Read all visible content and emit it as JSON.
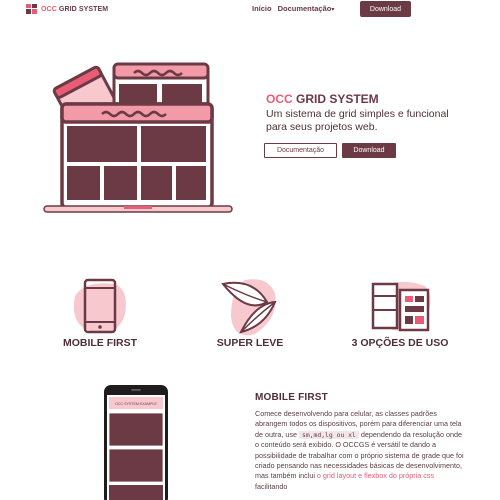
{
  "header": {
    "logo_accent": "OCC",
    "logo_rest": " GRID SYSTEM",
    "nav": [
      {
        "label": "Início"
      },
      {
        "label": "Documentação"
      }
    ],
    "nav_caret": "▾",
    "download_label": "Download"
  },
  "hero": {
    "title_accent": "OCC",
    "title_rest": " GRID SYSTEM",
    "subtitle": "Um sistema de grid simples e funcional para seus projetos web.",
    "btn_docs": "Documentação",
    "btn_download": "Download"
  },
  "features": [
    {
      "label": "MOBILE FIRST",
      "icon": "smartphone-icon"
    },
    {
      "label": "SUPER LEVE",
      "icon": "feather-icon"
    },
    {
      "label": "3 OPÇÕES DE USO",
      "icon": "layout-icon"
    }
  ],
  "mobile_section": {
    "phone_header": "OCC SYSTEM EXAMPLE",
    "title": "MOBILE FIRST",
    "p1": "Comece desenvolvendo para celular, as classes padrões abrangem todos os dispositivos, porém para diferenciar uma tela de outra, use ",
    "code": "sm,md,lg ou xl",
    "p2": " dependendo da resolução onde o conteúdo será exibido. O OCCGS é versátil te dando a possibilidade de trabalhar com o próprio sistema de grade que foi criado pensando nas necessidades básicas de desenvolvimento, mas também inclui ",
    "link": "o grid layout e flexbox do própria css",
    "p3": " facilitando"
  },
  "colors": {
    "brand": "#6b3a45",
    "accent": "#e85d75",
    "light_pink": "#f7c9cf"
  }
}
